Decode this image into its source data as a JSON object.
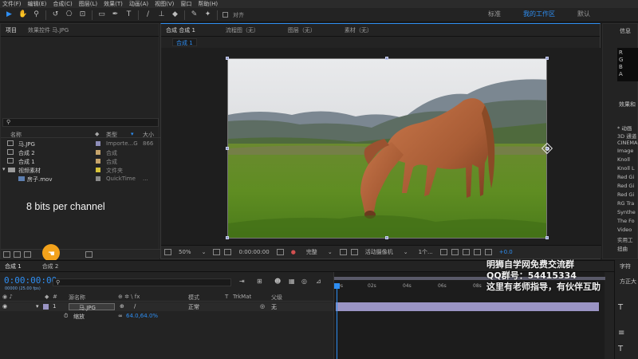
{
  "menu": [
    "文件(F)",
    "编辑(E)",
    "合成(C)",
    "图层(L)",
    "效果(T)",
    "动画(A)",
    "视图(V)",
    "窗口",
    "帮助(H)"
  ],
  "toolbar": {
    "align_label": "对齐",
    "workspaces": [
      "标准",
      "我的工作区",
      "默认"
    ]
  },
  "project_panel": {
    "tabs": [
      "项目",
      "效果控件 马.JPG"
    ],
    "columns": [
      "名称",
      "类型",
      "大小"
    ],
    "items": [
      {
        "name": "马.JPG",
        "type": "Importe...G",
        "size": "866",
        "label_color": "#8d8db8"
      },
      {
        "name": "合成 2",
        "type": "合成",
        "size": "",
        "label_color": "#c6a46b"
      },
      {
        "name": "合成 1",
        "type": "合成",
        "size": "",
        "label_color": "#c6a46b"
      },
      {
        "name": "视频素材",
        "type": "文件夹",
        "size": "",
        "label_color": "#d6c33a"
      },
      {
        "name": "房子.mov",
        "type": "QuickTime",
        "size": "...",
        "label_color": "#8a8a8a"
      }
    ],
    "bit_depth": "8 bits per channel"
  },
  "viewer": {
    "tabs": [
      "合成 合成 1",
      "流程图（无）",
      "图层（无）",
      "素材（无）"
    ],
    "breadcrumb": "合成 1",
    "zoom": "50%",
    "timecode": "0:00:00:00",
    "resolution": "完整",
    "camera": "活动摄像机",
    "views": "1个...",
    "exposure": "+0.0"
  },
  "info_panel": {
    "title": "信息",
    "rgb": [
      "R",
      "G",
      "B",
      "A"
    ],
    "effects_title": "效果和",
    "effects": [
      "* 动画",
      "3D 通道",
      "CINEMA",
      "Image",
      "Knoll",
      "Knoll L",
      "Red Gi",
      "Red Gi",
      "Red Gi",
      "RG Tra",
      "Synthe",
      "The Fo",
      "Video",
      "实用工",
      "扭曲"
    ]
  },
  "timeline": {
    "tabs": [
      "合成 1",
      "合成 2"
    ],
    "timecode": "0:00:00:00",
    "timecode_sub": "00000 (25.00 fps)",
    "columns": [
      "源名称",
      "模式",
      "T",
      "TrkMat",
      "父级"
    ],
    "layer": {
      "index": "1",
      "name": "马.JPG",
      "mode": "正常",
      "parent": "无"
    },
    "property": {
      "name": "缩放",
      "value": "64.0,64.0%"
    },
    "ruler_ticks": [
      "0s",
      "02s",
      "04s",
      "06s",
      "08s"
    ]
  },
  "watermark": [
    "明狮自学网免费交流群",
    "QQ群号：54415334",
    "这里有老师指导，有伙伴互助"
  ],
  "right_bottom": {
    "char_title": "字符",
    "font": "方正大"
  }
}
